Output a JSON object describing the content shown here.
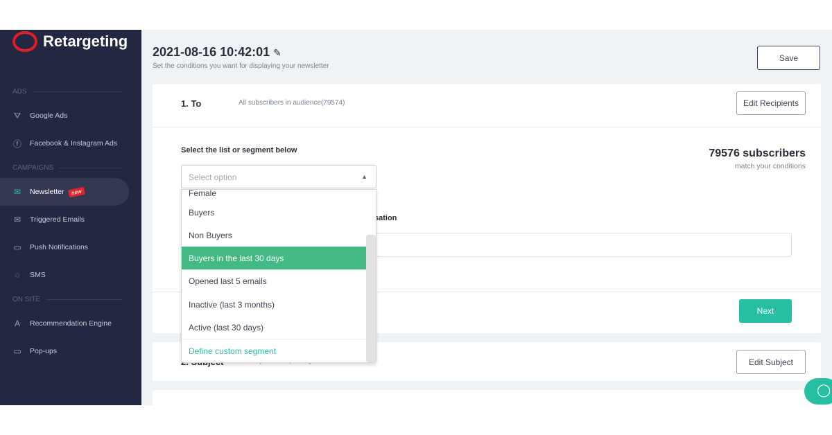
{
  "sidebar": {
    "brand": "Retargeting",
    "sections": [
      "ADS",
      "CAMPAIGNS",
      "ON SITE"
    ],
    "items": [
      {
        "label": "Google Ads",
        "icon": "google-ads-icon"
      },
      {
        "label": "Facebook & Instagram Ads",
        "icon": "facebook-icon"
      },
      {
        "label": "Newsletter",
        "icon": "newsletter-icon",
        "badge": "new",
        "active": true
      },
      {
        "label": "Triggered Emails",
        "icon": "envelope-icon"
      },
      {
        "label": "Push Notifications",
        "icon": "chat-icon"
      },
      {
        "label": "SMS",
        "icon": "sms-icon"
      },
      {
        "label": "Recommendation Engine",
        "icon": "ai-icon"
      },
      {
        "label": "Pop-ups",
        "icon": "window-icon"
      }
    ]
  },
  "header": {
    "title": "2021-08-16 10:42:01",
    "subtitle": "Set the conditions you want for displaying your newsletter",
    "save": "Save"
  },
  "to": {
    "label": "1. To",
    "summary": "All subscribers in audience(79574)",
    "edit": "Edit Recipients",
    "select_label": "Select the list or segment below",
    "placeholder": "Select option",
    "count": "79576 subscribers",
    "count_sub": "match your conditions",
    "hidden_label_tail": "sation",
    "next": "Next"
  },
  "dropdown": {
    "options": [
      "Female",
      "Buyers",
      "Non Buyers",
      "Buyers in the last 30 days",
      "Opened last 5 emails",
      "Inactive (last 3 months)",
      "Active (last 30 days)"
    ],
    "selected": "Buyers in the last 30 days",
    "custom": "Define custom segment"
  },
  "subject": {
    "label": "2. Subject",
    "value": "Tot ce-ți mai bun, doar pentru TINE!",
    "edit": "Edit Subject"
  },
  "colors": {
    "accent": "#26bfa3",
    "sidebar": "#232742",
    "highlight": "#43b983"
  }
}
